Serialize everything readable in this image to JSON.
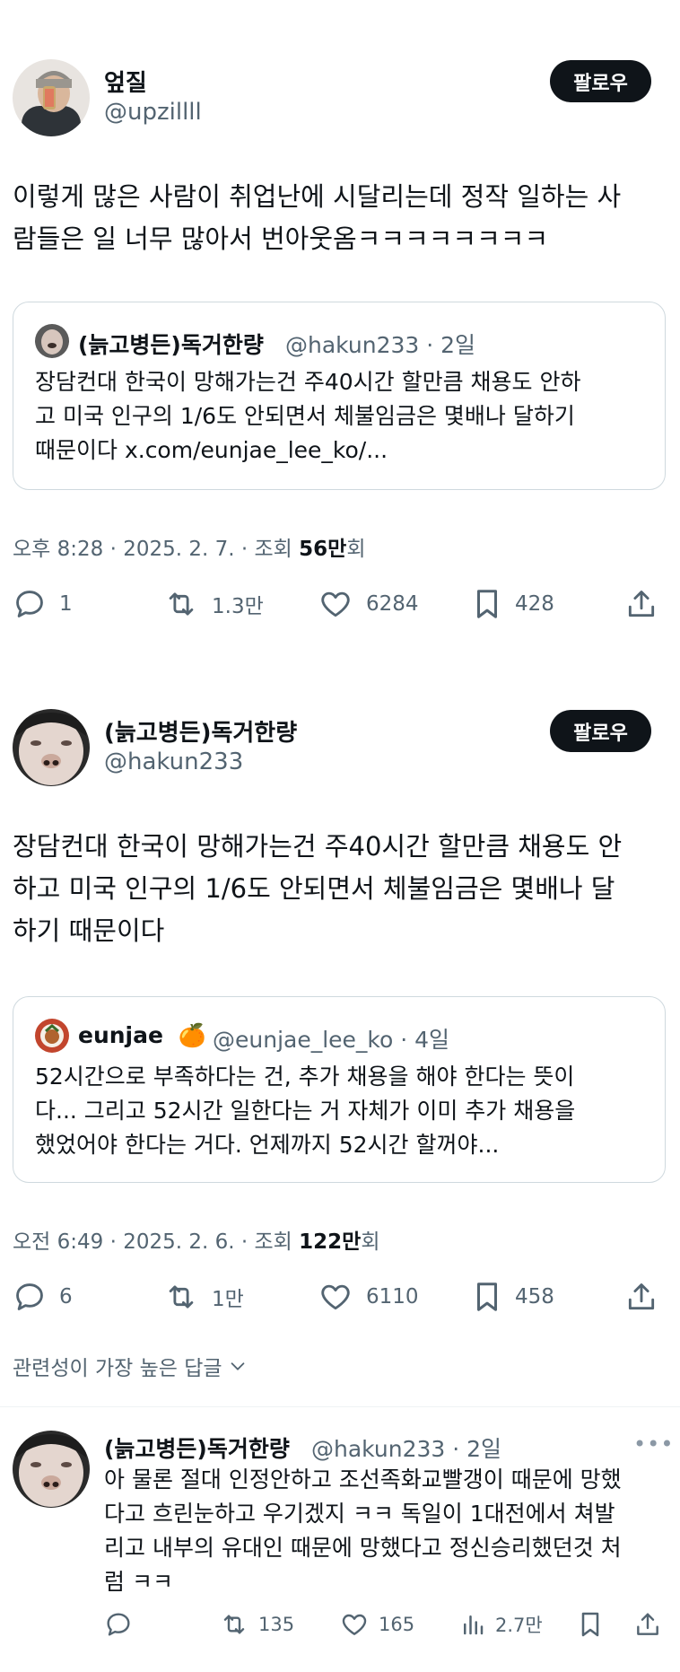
{
  "tweet1": {
    "name": "엎질",
    "handle": "@upzillll",
    "follow_label": "팔로우",
    "text": "이렇게 많은 사람이 취업난에 시달리는데 정작 일하는 사\n람들은 일 너무 많아서 번아웃옴ㅋㅋㅋㅋㅋㅋㅋㅋ",
    "quote": {
      "name": "(늙고병든)독거한량",
      "handle_time": "@hakun233 · 2일",
      "text": "장담컨대 한국이 망해가는건 주40시간 할만큼 채용도 안하\n고 미국 인구의 1/6도 안되면서 체불임금은 몇배나 달하기\n때문이다 x.com/eunjae_lee_ko/..."
    },
    "meta_time": "오후 8:28 · 2025. 2. 7. · 조회 ",
    "meta_views": "56만",
    "meta_suffix": "회",
    "stats": {
      "replies": "1",
      "retweets": "1.3만",
      "likes": "6284",
      "bookmarks": "428"
    }
  },
  "tweet2": {
    "name": "(늙고병든)독거한량",
    "handle": "@hakun233",
    "follow_label": "팔로우",
    "text": "장담컨대 한국이 망해가는건 주40시간 할만큼 채용도 안\n하고 미국 인구의 1/6도 안되면서 체불임금은 몇배나 달\n하기 때문이다",
    "quote": {
      "name": "eunjae",
      "emoji": "🍊",
      "handle_time": "@eunjae_lee_ko · 4일",
      "text": "52시간으로 부족하다는 건, 추가 채용을 해야 한다는 뜻이\n다... 그리고 52시간 일한다는 거 자체가 이미 추가 채용을\n했었어야 한다는 거다. 언제까지 52시간 할꺼야..."
    },
    "meta_time": "오전 6:49 · 2025. 2. 6. · 조회 ",
    "meta_views": "122만",
    "meta_suffix": "회",
    "stats": {
      "replies": "6",
      "retweets": "1만",
      "likes": "6110",
      "bookmarks": "458"
    }
  },
  "replies_label": "관련성이 가장 높은 답글",
  "reply": {
    "name": "(늙고병든)독거한량",
    "handle_time": "@hakun233 · 2일",
    "text": "아 물론 절대 인정안하고 조선족화교빨갱이 때문에 망했\n다고 흐린눈하고 우기겠지 ㅋㅋ 독일이 1대전에서 쳐발\n리고 내부의 유대인 때문에 망했다고 정신승리했던것 처\n럼 ㅋㅋ",
    "stats": {
      "retweets": "135",
      "likes": "165",
      "views": "2.7만"
    }
  },
  "colors": {
    "text": "#0f1419",
    "muted": "#536471",
    "border": "#cfd9de",
    "button": "#0f1419"
  }
}
